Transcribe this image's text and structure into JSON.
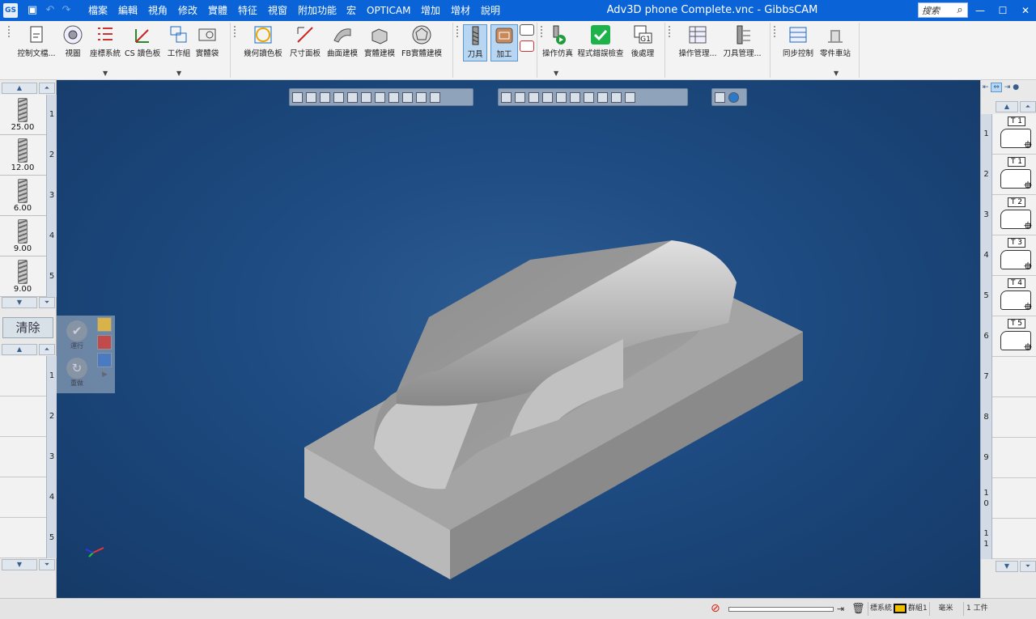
{
  "window": {
    "title": "Adv3D phone Complete.vnc - GibbsCAM",
    "search_placeholder": "搜索",
    "app_icon": "gibbscam-logo-icon",
    "controls": [
      "minimize-icon",
      "maximize-icon",
      "close-icon"
    ]
  },
  "menu": [
    "檔案",
    "編輯",
    "視角",
    "修改",
    "實體",
    "特征",
    "視窗",
    "附加功能",
    "宏",
    "OPTICAM",
    "增加",
    "增材",
    "說明"
  ],
  "ribbon": {
    "groups": [
      {
        "tools": [
          "控制文檔...",
          "視圖",
          "座標系統",
          "CS",
          "讀色板",
          "工作組",
          "實體袋"
        ]
      },
      {
        "tools": [
          "幾何讀色板",
          "尺寸面板",
          "曲面建模",
          "實體建模",
          "FB實體建模"
        ]
      },
      {
        "tools": [
          "刀具",
          "加工"
        ]
      },
      {
        "tools": [
          "操作仿真",
          "程式錯誤檢查",
          "後處理"
        ]
      },
      {
        "tools": [
          "操作管理...",
          "刀具管理..."
        ]
      },
      {
        "tools": [
          "同步控制",
          "零件車站"
        ]
      }
    ],
    "post_badge": "G1"
  },
  "left_panel": {
    "tools": [
      {
        "num": "1",
        "value": "25.00"
      },
      {
        "num": "2",
        "value": "12.00"
      },
      {
        "num": "3",
        "value": "6.00"
      },
      {
        "num": "4",
        "value": "9.00"
      },
      {
        "num": "5",
        "value": "9.00"
      }
    ],
    "clear_label": "清除",
    "run_label": "運行",
    "redo_label": "重做",
    "slots": [
      "1",
      "2",
      "3",
      "4",
      "5"
    ]
  },
  "right_panel": {
    "ops": [
      {
        "num": "1",
        "tool": "T 1"
      },
      {
        "num": "2",
        "tool": "T 1"
      },
      {
        "num": "3",
        "tool": "T 2"
      },
      {
        "num": "4",
        "tool": "T 3"
      },
      {
        "num": "5",
        "tool": "T 4"
      },
      {
        "num": "6",
        "tool": "T 5"
      },
      {
        "num": "7",
        "tool": ""
      },
      {
        "num": "8",
        "tool": ""
      },
      {
        "num": "9",
        "tool": ""
      },
      {
        "num": "1\n0",
        "tool": ""
      },
      {
        "num": "1\n1",
        "tool": ""
      }
    ]
  },
  "status": {
    "coord_label": "標系統",
    "group_label": "群組1",
    "unit": "毫米",
    "parts": "1 工件"
  },
  "colors": {
    "titlebar": "#0a64d8",
    "viewport_bg": "#1d4a80",
    "model": "#a8a8a8"
  }
}
